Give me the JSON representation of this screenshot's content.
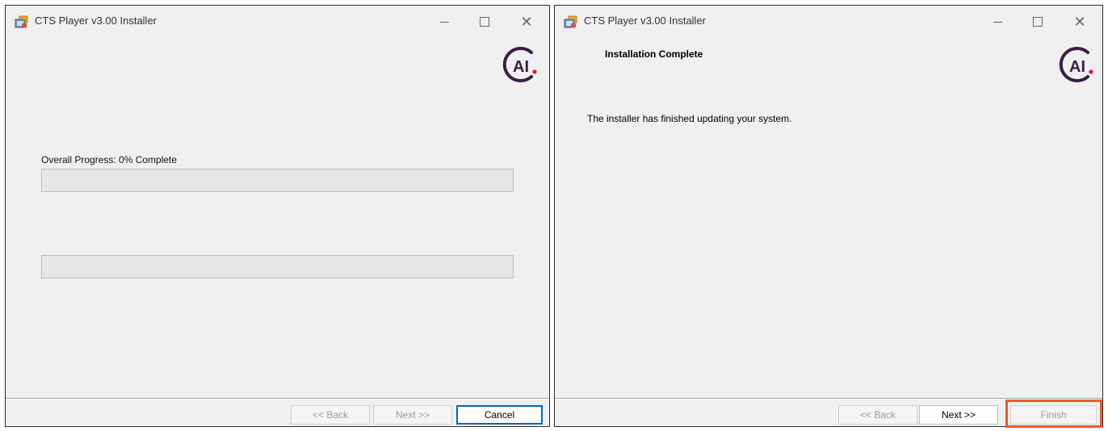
{
  "colors": {
    "highlight": "#f05a23",
    "logo_primary": "#3a1e46",
    "logo_dot": "#e8163b",
    "default_button_border": "#0067c0"
  },
  "left_window": {
    "title": "CTS Player v3.00 Installer",
    "app_icon": "installer-icon",
    "logo_text": "AI",
    "progress_label": "Overall Progress: 0% Complete",
    "overall_progress_percent": 0,
    "secondary_progress_percent": 0,
    "buttons": {
      "back": "<< Back",
      "next": "Next >>",
      "cancel": "Cancel"
    }
  },
  "right_window": {
    "title": "CTS Player v3.00 Installer",
    "app_icon": "installer-icon",
    "logo_text": "AI",
    "heading": "Installation Complete",
    "message": "The installer has finished updating your system.",
    "buttons": {
      "back": "<< Back",
      "next": "Next >>",
      "finish": "Finish"
    }
  }
}
